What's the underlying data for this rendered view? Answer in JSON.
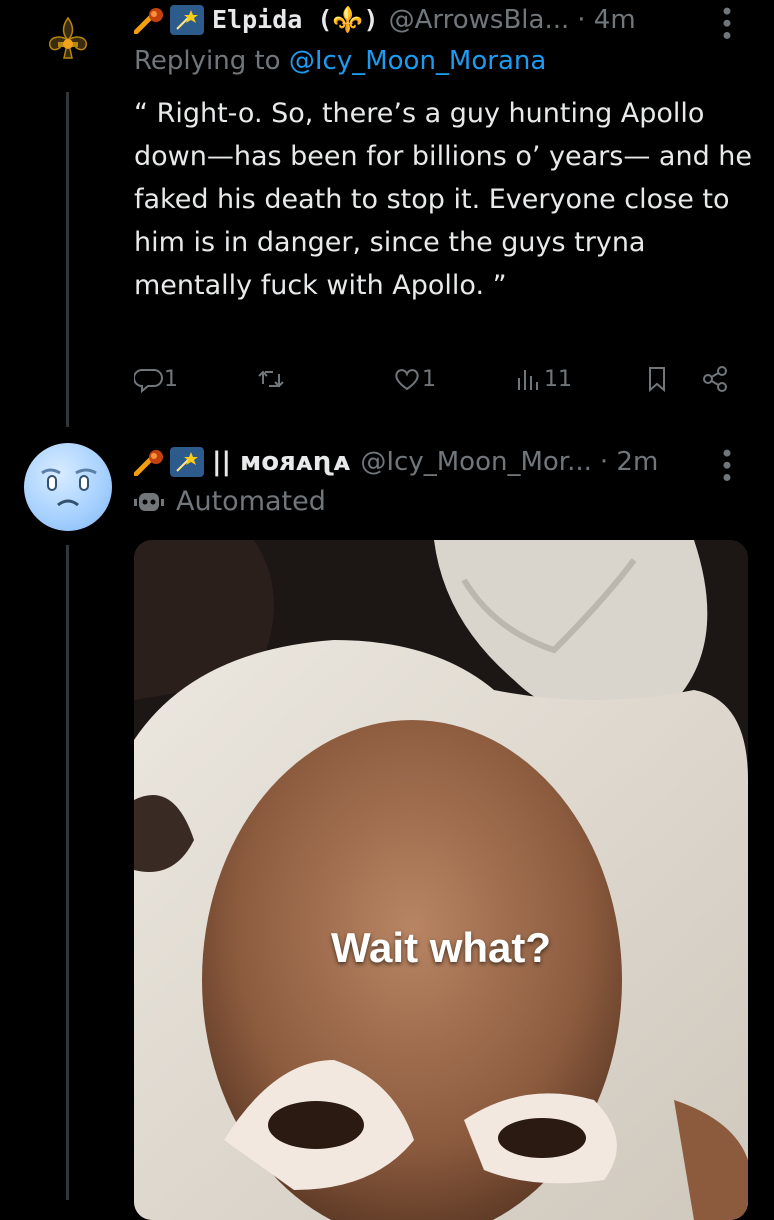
{
  "tweets": [
    {
      "display_name": "Elpida (⚜️)",
      "handle": "@ArrowsBla...",
      "time": "· 4m",
      "replying_prefix": "Replying to ",
      "replying_to": "@Icy_Moon_Morana",
      "text": "“ Right-o. So, there’s a guy hunting Apollo down—has been for billions o’ years— and he faked his death to stop it. Everyone close to him is in danger, since the guys tryna mentally fuck with Apollo. ”",
      "actions": {
        "replies": "1",
        "retweets": "",
        "likes": "1",
        "views": "11"
      }
    },
    {
      "display_name": "|| ᴍᴏᴙᴀɳᴀ",
      "handle": "@Icy_Moon_Mor...",
      "time": "· 2m",
      "automated_label": "Automated",
      "media": {
        "caption": "Wait what?"
      }
    }
  ],
  "icons": [
    "meteor-emoji",
    "shooting-star-emoji",
    "fleur-de-lis-avatar",
    "more-icon",
    "reply-icon",
    "retweet-icon",
    "like-icon",
    "views-icon",
    "bookmark-icon",
    "share-icon",
    "robot-icon"
  ],
  "colors": {
    "background": "#000000",
    "text": "#e7e9ea",
    "muted": "#71767b",
    "link": "#1d9bf0"
  }
}
